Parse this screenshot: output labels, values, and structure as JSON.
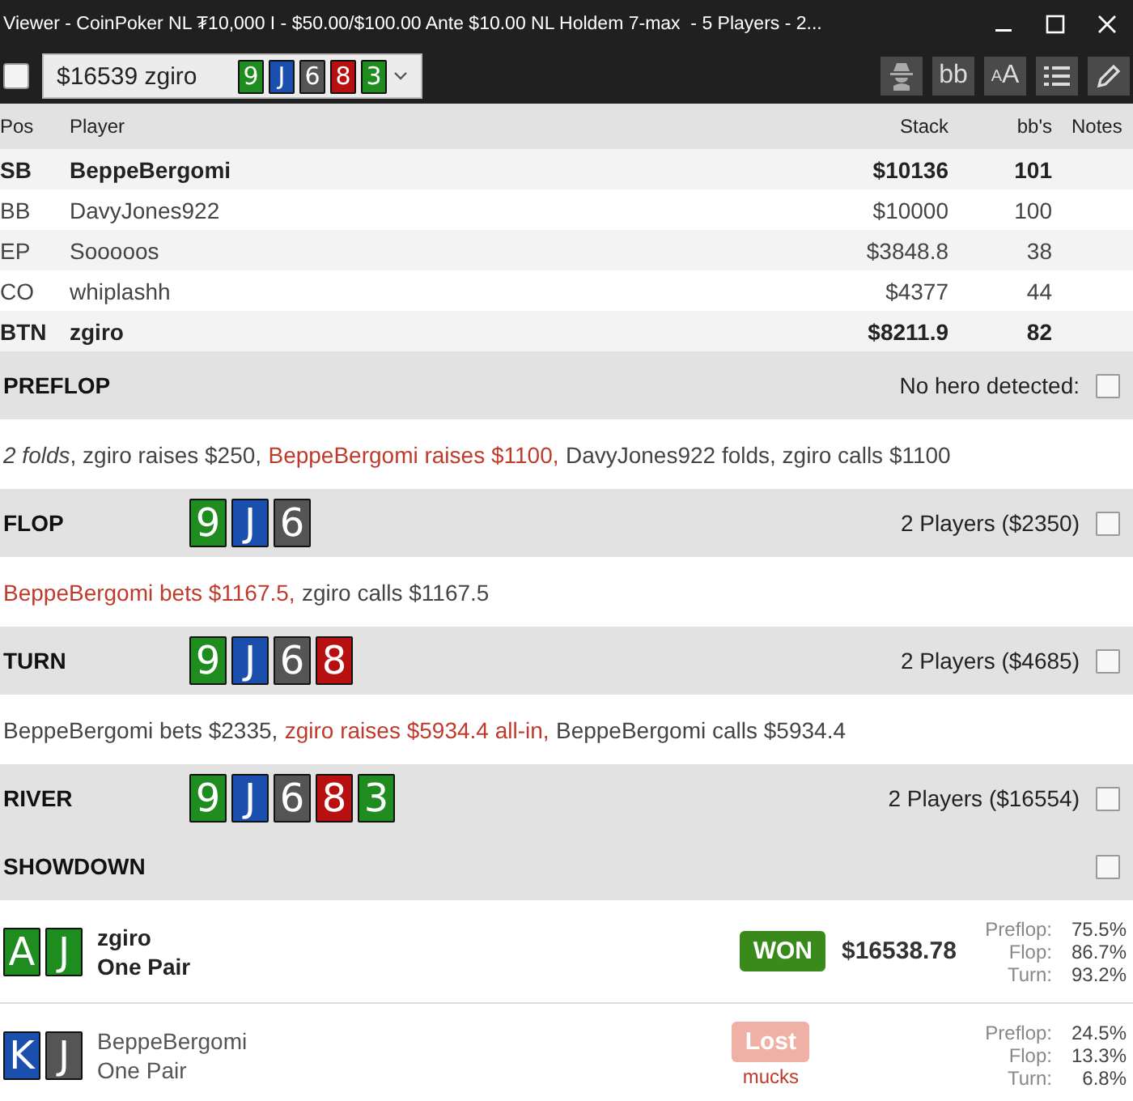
{
  "window": {
    "title": "Viewer - CoinPoker NL ₮10,000 I - $50.00/$100.00 Ante $10.00 NL Holdem 7-max  - 5 Players - 2..."
  },
  "toolbar": {
    "checkbox": {
      "checked": false
    },
    "hand_select": {
      "value": "$16539 zgiro",
      "cards": [
        {
          "rank": "9",
          "color": "#1e8c1e"
        },
        {
          "rank": "J",
          "color": "#1a4fae"
        },
        {
          "rank": "6",
          "color": "#555555"
        },
        {
          "rank": "8",
          "color": "#b81010"
        },
        {
          "rank": "3",
          "color": "#1e8c1e"
        }
      ]
    },
    "buttons": [
      {
        "kind": "spy"
      },
      {
        "kind": "text",
        "label": "bb"
      },
      {
        "kind": "fontsize",
        "small": "A",
        "large": "A"
      },
      {
        "kind": "list"
      },
      {
        "kind": "pencil"
      }
    ]
  },
  "table": {
    "columns": [
      "Pos",
      "Player",
      "Stack",
      "bb's",
      "Notes"
    ],
    "rows": [
      {
        "pos": "SB",
        "player": "BeppeBergomi",
        "stack": "$10136",
        "bbs": "101",
        "bold": true
      },
      {
        "pos": "BB",
        "player": "DavyJones922",
        "stack": "$10000",
        "bbs": "100",
        "bold": false
      },
      {
        "pos": "EP",
        "player": "Sooooos",
        "stack": "$3848.8",
        "bbs": "38",
        "bold": false
      },
      {
        "pos": "CO",
        "player": "whiplashh",
        "stack": "$4377",
        "bbs": "44",
        "bold": false
      },
      {
        "pos": "BTN",
        "player": "zgiro",
        "stack": "$8211.9",
        "bbs": "82",
        "bold": true
      }
    ]
  },
  "streets": [
    {
      "name": "PREFLOP",
      "info": "No hero detected:",
      "checked": false,
      "actions": [
        {
          "text": "*2 folds*, zgiro raises $250, ",
          "highlight": false
        },
        {
          "text": "BeppeBergomi raises $1100,",
          "highlight": true
        },
        {
          "text": " DavyJones922 folds, zgiro calls $1100",
          "highlight": false
        }
      ]
    },
    {
      "name": "FLOP",
      "cards": [
        {
          "rank": "9",
          "color": "#1e8c1e"
        },
        {
          "rank": "J",
          "color": "#1a4fae"
        },
        {
          "rank": "6",
          "color": "#555555"
        }
      ],
      "info": "2 Players ($2350)",
      "checked": false,
      "actions": [
        {
          "text": "BeppeBergomi bets $1167.5,",
          "highlight": true
        },
        {
          "text": " zgiro calls $1167.5",
          "highlight": false
        }
      ]
    },
    {
      "name": "TURN",
      "cards": [
        {
          "rank": "9",
          "color": "#1e8c1e"
        },
        {
          "rank": "J",
          "color": "#1a4fae"
        },
        {
          "rank": "6",
          "color": "#555555"
        },
        {
          "rank": "8",
          "color": "#b81010"
        }
      ],
      "info": "2 Players ($4685)",
      "checked": false,
      "actions": [
        {
          "text": "BeppeBergomi bets $2335, ",
          "highlight": false
        },
        {
          "text": "zgiro raises $5934.4 all-in,",
          "highlight": true
        },
        {
          "text": " BeppeBergomi calls $5934.4",
          "highlight": false
        }
      ]
    },
    {
      "name": "RIVER",
      "cards": [
        {
          "rank": "9",
          "color": "#1e8c1e"
        },
        {
          "rank": "J",
          "color": "#1a4fae"
        },
        {
          "rank": "6",
          "color": "#555555"
        },
        {
          "rank": "8",
          "color": "#b81010"
        },
        {
          "rank": "3",
          "color": "#1e8c1e"
        }
      ],
      "info": "2 Players ($16554)",
      "checked": false
    },
    {
      "name": "SHOWDOWN",
      "checked": false
    }
  ],
  "showdown": [
    {
      "kind": "won",
      "cards": [
        {
          "rank": "A",
          "color": "#1e8c1e"
        },
        {
          "rank": "J",
          "color": "#1e8c1e"
        }
      ],
      "player": "zgiro",
      "hand": "One Pair",
      "badge": "WON",
      "amount": "$16538.78",
      "equity": [
        {
          "label": "Preflop:",
          "value": "75.5%"
        },
        {
          "label": "Flop:",
          "value": "86.7%"
        },
        {
          "label": "Turn:",
          "value": "93.2%"
        }
      ]
    },
    {
      "kind": "lost",
      "cards": [
        {
          "rank": "K",
          "color": "#1a4fae"
        },
        {
          "rank": "J",
          "color": "#555555"
        }
      ],
      "player": "BeppeBergomi",
      "hand": "One Pair",
      "badge": "Lost",
      "note": "mucks",
      "equity": [
        {
          "label": "Preflop:",
          "value": "24.5%"
        },
        {
          "label": "Flop:",
          "value": "13.3%"
        },
        {
          "label": "Turn:",
          "value": "6.8%"
        }
      ]
    }
  ]
}
